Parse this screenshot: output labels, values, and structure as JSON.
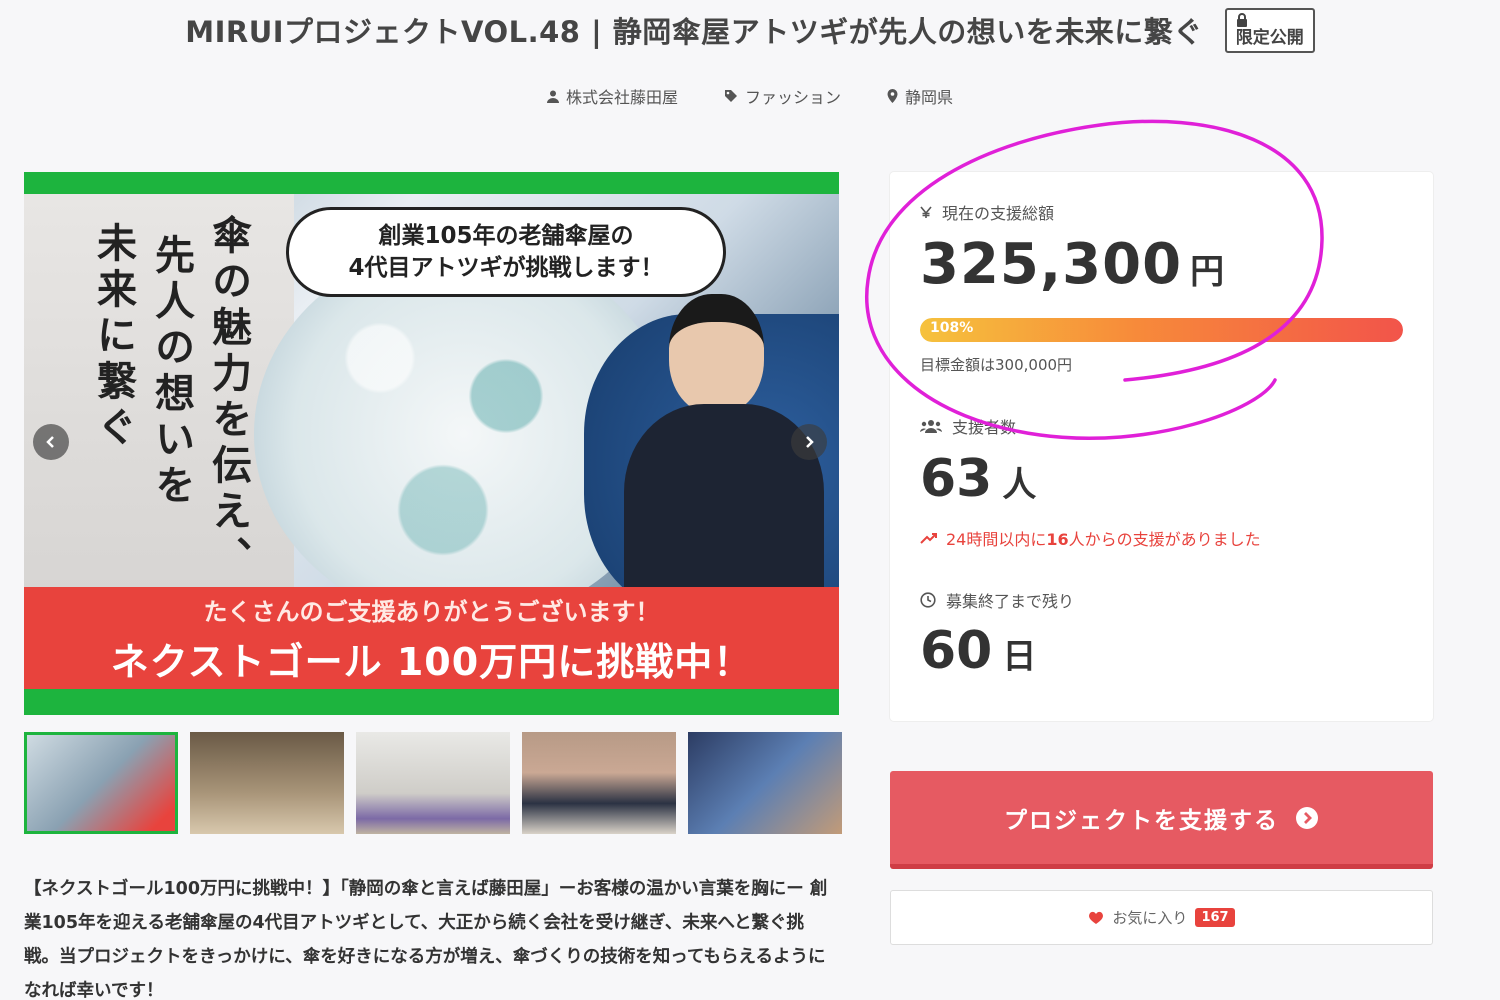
{
  "header": {
    "title": "MIRUIプロジェクトVOL.48 | 静岡傘屋アトツギが先人の想いを未来に繋ぐ",
    "badge": "限定公開",
    "company": "株式会社藤田屋",
    "category": "ファッション",
    "location": "静岡県"
  },
  "hero": {
    "vertical_1": "傘の魅力を伝え、",
    "vertical_2": "先人の想いを",
    "vertical_3": "未来に繋ぐ",
    "bubble_line1": "創業105年の老舗傘屋の",
    "bubble_line2": "4代目アトツギが挑戦します！",
    "banner_line1": "たくさんのご支援ありがとうございます！",
    "banner_line2": "ネクストゴール 100万円に挑戦中！"
  },
  "description": "【ネクストゴール100万円に挑戦中！】「静岡の傘と言えば藤田屋」ーお客様の温かい言葉を胸にー 創業105年を迎える老舗傘屋の4代目アトツギとして、大正から続く会社を受け継ぎ、未来へと繋ぐ挑戦。当プロジェクトをきっかけに、傘を好きになる方が増え、傘づくりの技術を知ってもらえるようになれば幸いです！",
  "stats": {
    "amount_label": "現在の支援総額",
    "amount": "325,300",
    "amount_unit": "円",
    "progress_label": "108%",
    "progress_fraction": 1.0,
    "goal_text": "目標金額は300,000円",
    "supporters_label": "支援者数",
    "supporters": "63",
    "supporters_unit": "人",
    "recent_prefix": "24時間以内に",
    "recent_count": "16",
    "recent_suffix": "人からの支援がありました",
    "remaining_label": "募集終了まで残り",
    "days": "60",
    "days_unit": "日"
  },
  "actions": {
    "support_label": "プロジェクトを支援する",
    "favorite_label": "お気に入り",
    "favorite_count": "167"
  },
  "colors": {
    "accent_green": "#1db43e",
    "accent_red": "#e8433d",
    "button_red": "#e65a62",
    "annotation_magenta": "#e020d8"
  },
  "icons": [
    "lock-icon",
    "user-icon",
    "tag-icon",
    "location-pin-icon",
    "yen-icon",
    "users-icon",
    "trend-up-icon",
    "clock-icon",
    "chevron-right-circle-icon",
    "heart-icon",
    "arrow-left-icon",
    "arrow-right-icon"
  ]
}
